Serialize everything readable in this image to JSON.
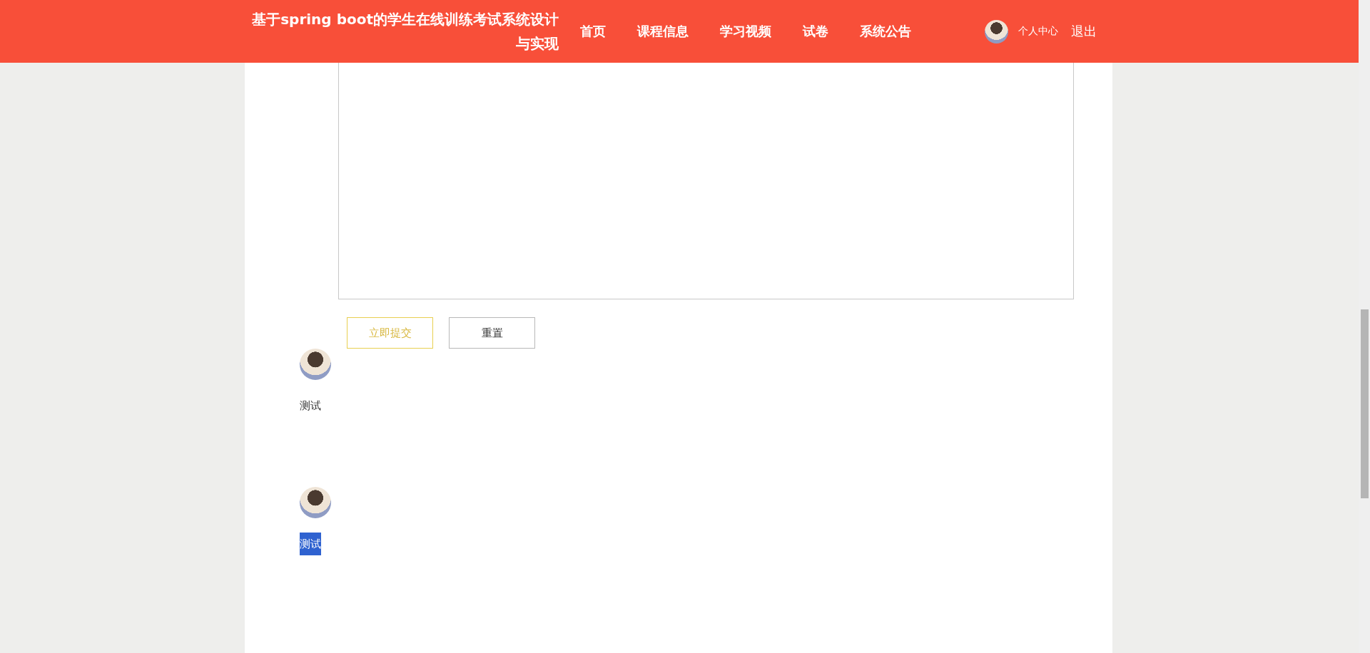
{
  "header": {
    "title": "基于spring boot的学生在线训练考试系统设计与实现",
    "nav": [
      {
        "label": "首页"
      },
      {
        "label": "课程信息"
      },
      {
        "label": "学习视频"
      },
      {
        "label": "试卷"
      },
      {
        "label": "系统公告"
      }
    ],
    "user_link": "个人中心",
    "logout": "退出"
  },
  "form": {
    "buttons": [
      {
        "label": "立即提交",
        "kind": "primary"
      },
      {
        "label": "重置",
        "kind": "default"
      }
    ]
  },
  "comments": [
    {
      "text": "测试",
      "highlighted": false
    },
    {
      "text": "测试",
      "highlighted": true
    }
  ]
}
